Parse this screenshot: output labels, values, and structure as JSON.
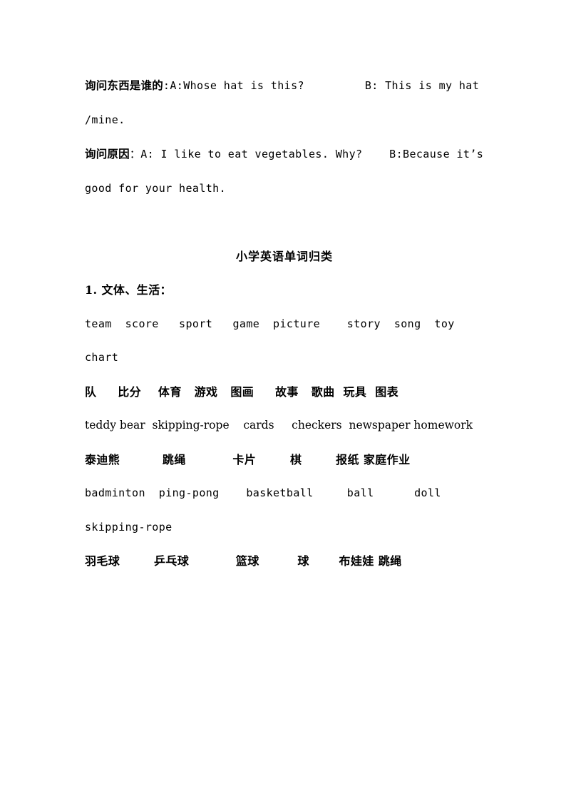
{
  "document": {
    "title_centered": "小学英语单词归类",
    "section_heading": "1. 文体、生活：",
    "qa_blocks": [
      {
        "label": "询问东西是谁的",
        "body": ":A:Whose hat is this?         B: This is my hat /mine."
      },
      {
        "label": "询问原因",
        "body": "：A: I like to eat vegetables. Why?    B:Because it’s good for your health."
      }
    ],
    "vocab_groups": [
      {
        "english": "team  score   sport   game  picture    story  song  toy chart",
        "chinese": "队     比分    体育   游戏   图画     故事   歌曲  玩具  图表"
      },
      {
        "english": "teddy bear  skipping-rope    cards     checkers  newspaper homework",
        "chinese": "泰迪熊          跳绳           卡片        棋        报纸 家庭作业"
      },
      {
        "english": "badminton  ping-pong    basketball     ball      doll skipping-rope",
        "chinese": "羽毛球        乒乓球           篮球         球       布娃娃 跳绳"
      }
    ]
  }
}
